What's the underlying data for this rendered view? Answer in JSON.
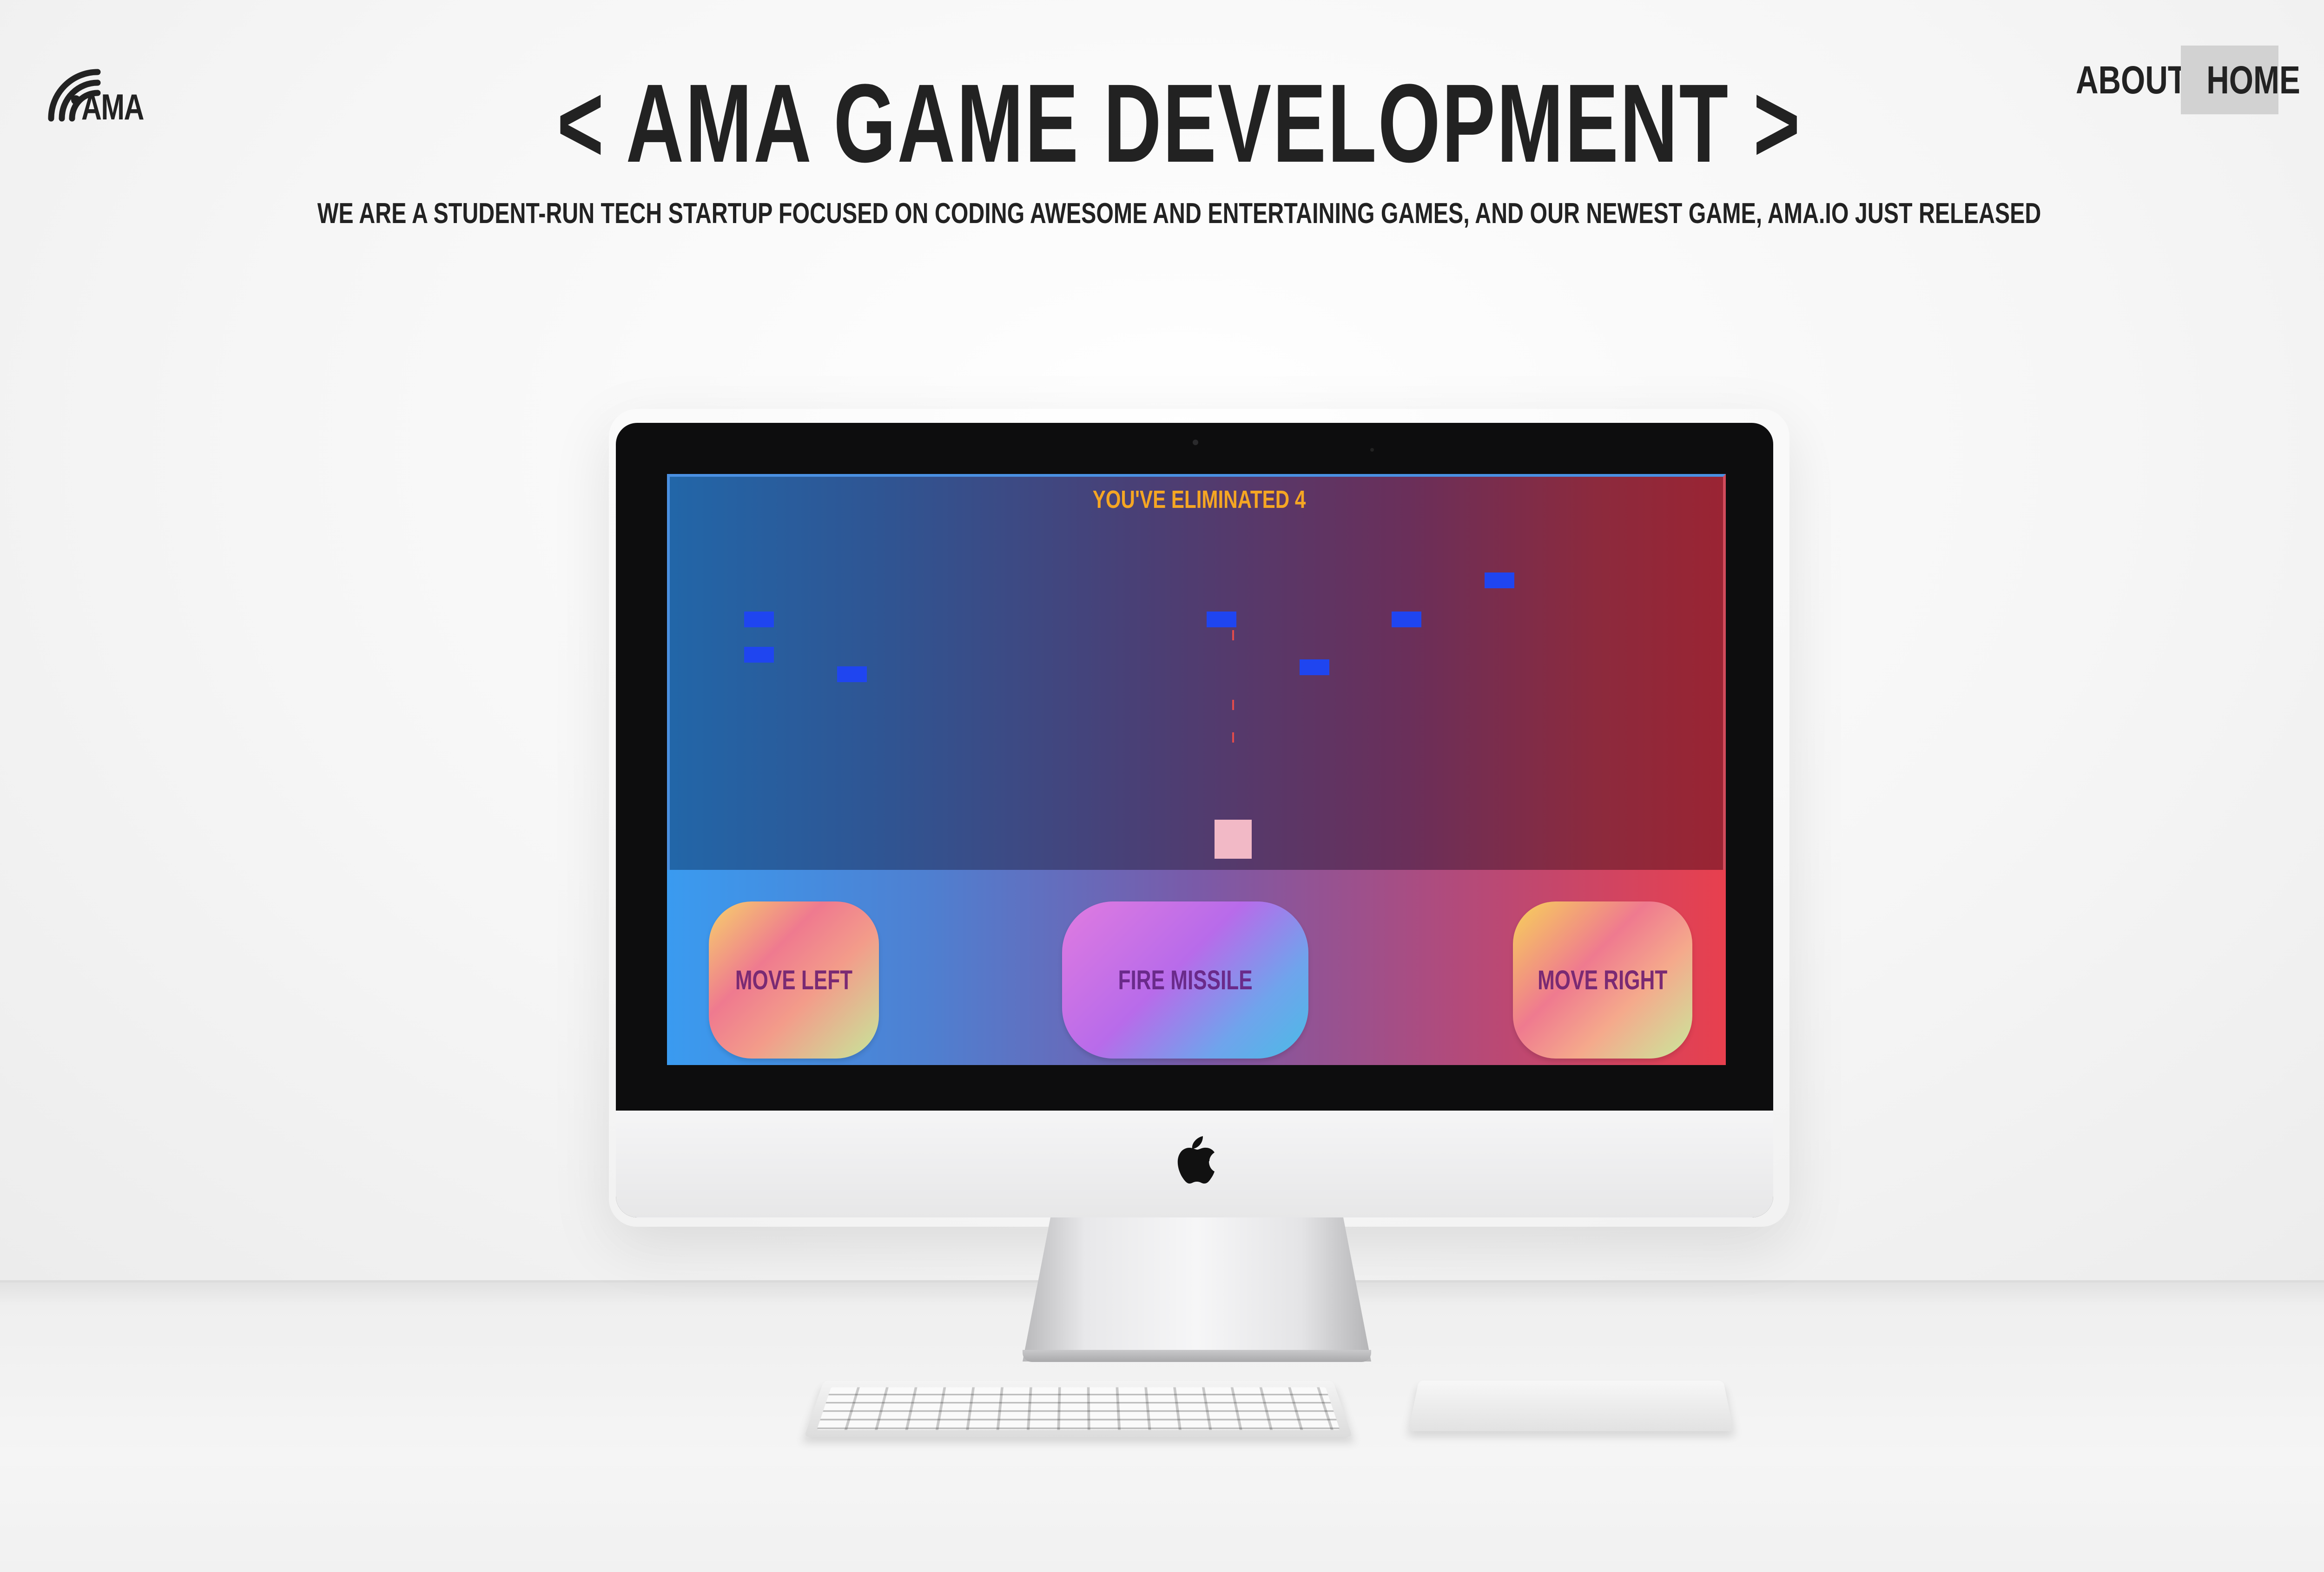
{
  "header": {
    "logo_text": "AMA",
    "title": "< AMA GAME DEVELOPMENT >",
    "subtitle": "WE ARE A STUDENT-RUN TECH STARTUP FOCUSED ON CODING AWESOME AND ENTERTAINING GAMES, AND OUR NEWEST GAME, AMA.IO JUST RELEASED"
  },
  "nav": {
    "items": [
      {
        "label": "ABOUT",
        "active": false
      },
      {
        "label": "HOME",
        "active": true
      }
    ]
  },
  "game": {
    "score_text": "YOU'VE ELIMINATED 4",
    "colors": {
      "score": "#f5a623",
      "enemy": "#1f45f0",
      "player": "#f2b9c6",
      "missile": "#e24b4b"
    },
    "controls": {
      "move_left": "MOVE LEFT",
      "fire_missile": "FIRE MISSILE",
      "move_right": "MOVE RIGHT"
    }
  },
  "icons": {
    "logo": "signal-arcs-icon",
    "device_brand": "apple-logo-icon"
  }
}
